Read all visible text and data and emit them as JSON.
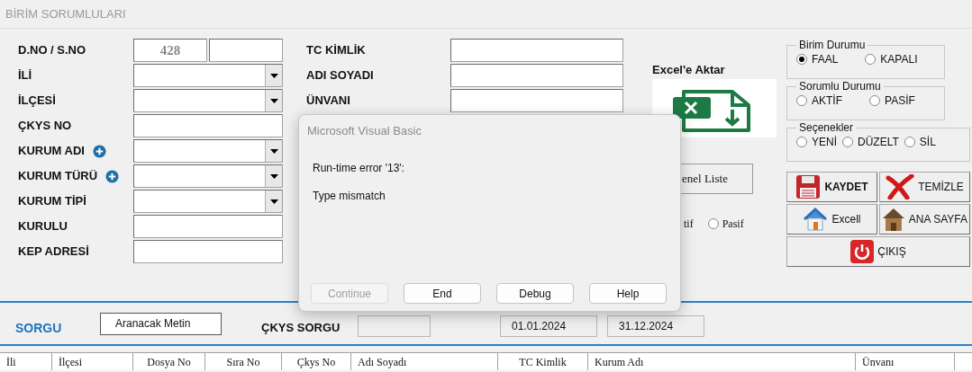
{
  "window": {
    "title": "BİRİM SORUMLULARI"
  },
  "form_left": [
    {
      "label": "D.NO / S.NO",
      "kind": "double",
      "value": "428",
      "add_button": false
    },
    {
      "label": "İLİ",
      "kind": "combo",
      "add_button": false
    },
    {
      "label": "İLÇESİ",
      "kind": "combo",
      "add_button": false
    },
    {
      "label": "ÇKYS NO",
      "kind": "text",
      "add_button": false
    },
    {
      "label": "KURUM ADI",
      "kind": "combo",
      "add_button": true
    },
    {
      "label": "KURUM TÜRÜ",
      "kind": "combo",
      "add_button": true
    },
    {
      "label": "KURUM TİPİ",
      "kind": "combo",
      "add_button": false
    },
    {
      "label": "KURULU",
      "kind": "text",
      "add_button": false
    },
    {
      "label": "KEP ADRESİ",
      "kind": "text",
      "add_button": false
    }
  ],
  "form_middle": [
    {
      "label": "TC KİMLİK"
    },
    {
      "label": "ADI SOYADI"
    },
    {
      "label": "ÜNVANI"
    }
  ],
  "excel_export": {
    "label": "Excel'e Aktar"
  },
  "list_button": {
    "label": "enel Liste"
  },
  "status_filter": {
    "covered_label": "tif",
    "option": {
      "label": "Pasif",
      "selected": false
    }
  },
  "groups": [
    {
      "title": "Birim Durumu",
      "options": [
        {
          "label": "FAAL",
          "selected": true
        },
        {
          "label": "KAPALI",
          "selected": false
        }
      ]
    },
    {
      "title": "Sorumlu Durumu",
      "options": [
        {
          "label": "AKTİF",
          "selected": false
        },
        {
          "label": "PASİF",
          "selected": false
        }
      ]
    },
    {
      "title": "Seçenekler",
      "options": [
        {
          "label": "YENİ",
          "selected": false
        },
        {
          "label": "DÜZELT",
          "selected": false
        },
        {
          "label": "SİL",
          "selected": false
        }
      ]
    }
  ],
  "actions": [
    {
      "label": "KAYDET",
      "kind": "save",
      "bold": true
    },
    {
      "label": "TEMİZLE",
      "kind": "clear",
      "bold": false
    },
    {
      "label": "Excell",
      "kind": "excel",
      "bold": false
    },
    {
      "label": "ANA SAYFA",
      "kind": "home",
      "bold": false
    },
    {
      "label": "ÇIKIŞ",
      "kind": "exit",
      "bold": false
    }
  ],
  "search": {
    "title": "SORGU",
    "text_value": "Aranacak Metin",
    "ckys_label": "ÇKYS SORGU",
    "date_from": "01.01.2024",
    "date_to": "31.12.2024"
  },
  "table": {
    "columns": [
      {
        "label": "İli"
      },
      {
        "label": "İlçesi"
      },
      {
        "label": "Dosya No"
      },
      {
        "label": "Sıra No"
      },
      {
        "label": "Çkys No"
      },
      {
        "label": "Adı Soyadı"
      },
      {
        "label": "TC Kimlik"
      },
      {
        "label": "Kurum Adı"
      },
      {
        "label": "Ünvanı"
      }
    ]
  },
  "dialog": {
    "title": "Microsoft Visual Basic",
    "message": "Run-time error '13':",
    "detail": "Type mismatch",
    "buttons": [
      {
        "label": "Continue",
        "disabled": true
      },
      {
        "label": "End",
        "disabled": false
      },
      {
        "label": "Debug",
        "disabled": false
      },
      {
        "label": "Help",
        "disabled": false
      }
    ]
  }
}
